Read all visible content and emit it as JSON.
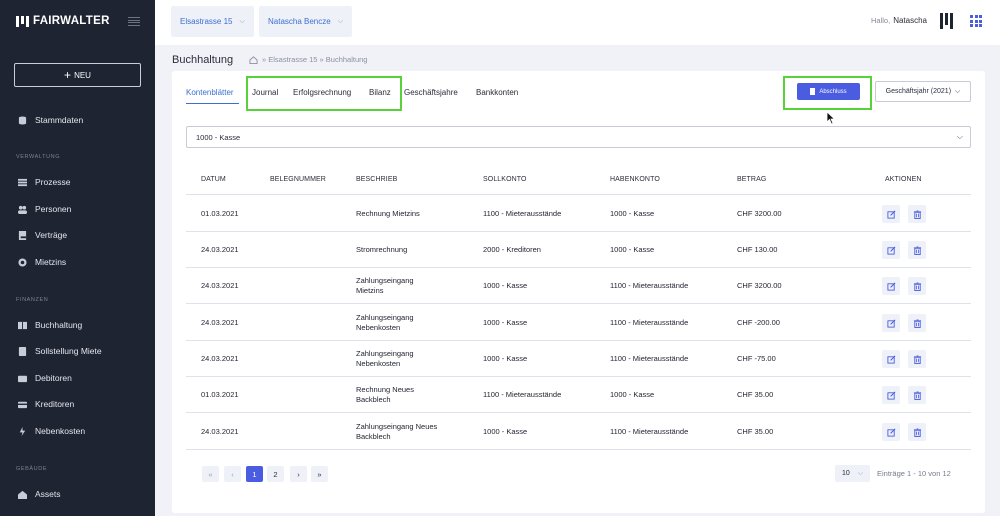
{
  "app": {
    "brand": "FAIRWALTER",
    "new_button": "NEU",
    "colors": {
      "accent": "#4a5ce0",
      "sidebar_bg": "#1f2433",
      "highlight": "#58d238",
      "link": "#3c6fd1"
    }
  },
  "sidebar": {
    "items": [
      {
        "label": "Stammdaten",
        "icon": "database-icon"
      },
      {
        "label": "Prozesse",
        "icon": "list-icon"
      },
      {
        "label": "Personen",
        "icon": "people-icon"
      },
      {
        "label": "Verträge",
        "icon": "contract-icon"
      },
      {
        "label": "Mietzins",
        "icon": "rent-icon"
      },
      {
        "label": "Buchhaltung",
        "icon": "ledger-icon"
      },
      {
        "label": "Sollstellung Miete",
        "icon": "invoice-icon"
      },
      {
        "label": "Debitoren",
        "icon": "debtor-icon"
      },
      {
        "label": "Kreditoren",
        "icon": "creditor-icon"
      },
      {
        "label": "Nebenkosten",
        "icon": "utility-icon"
      },
      {
        "label": "Assets",
        "icon": "assets-icon"
      }
    ],
    "sections": [
      "VERWALTUNG",
      "FINANZEN",
      "GEBÄUDE"
    ]
  },
  "topbar": {
    "property": "Elsastrasse 15",
    "owner": "Natascha Bencze",
    "greeting": "Hallo,",
    "user": "Natascha"
  },
  "page": {
    "title": "Buchhaltung",
    "breadcrumb": "» Elsastrasse 15 » Buchhaltung"
  },
  "tabs": [
    "Kontenblätter",
    "Journal",
    "Erfolgsrechnung",
    "Bilanz",
    "Geschäftsjahre",
    "Bankkonten"
  ],
  "abschluss_button": "Abschluss",
  "fiscal_year": "Geschäftsjahr (2021)",
  "account_select": "1000 - Kasse",
  "table": {
    "headers": [
      "DATUM",
      "BELEGNUMMER",
      "BESCHRIEB",
      "SOLLKONTO",
      "HABENKONTO",
      "BETRAG",
      "AKTIONEN"
    ],
    "rows": [
      {
        "datum": "01.03.2021",
        "beleg": "",
        "beschrieb": "Rechnung Mietzins",
        "beschrieb2": "",
        "soll": "1100 - Mieterausstände",
        "haben": "1000 - Kasse",
        "betrag": "CHF 3200.00"
      },
      {
        "datum": "24.03.2021",
        "beleg": "",
        "beschrieb": "Stromrechnung",
        "beschrieb2": "",
        "soll": "2000 - Kreditoren",
        "haben": "1000 - Kasse",
        "betrag": "CHF 130.00"
      },
      {
        "datum": "24.03.2021",
        "beleg": "",
        "beschrieb": "Zahlungseingang",
        "beschrieb2": "Mietzins",
        "soll": "1000 - Kasse",
        "haben": "1100 - Mieterausstände",
        "betrag": "CHF 3200.00"
      },
      {
        "datum": "24.03.2021",
        "beleg": "",
        "beschrieb": "Zahlungseingang",
        "beschrieb2": "Nebenkosten",
        "soll": "1000 - Kasse",
        "haben": "1100 - Mieterausstände",
        "betrag": "CHF -200.00"
      },
      {
        "datum": "24.03.2021",
        "beleg": "",
        "beschrieb": "Zahlungseingang",
        "beschrieb2": "Nebenkosten",
        "soll": "1000 - Kasse",
        "haben": "1100 - Mieterausstände",
        "betrag": "CHF -75.00"
      },
      {
        "datum": "01.03.2021",
        "beleg": "",
        "beschrieb": "Rechnung Neues",
        "beschrieb2": "Backblech",
        "soll": "1100 - Mieterausstände",
        "haben": "1000 - Kasse",
        "betrag": "CHF 35.00"
      },
      {
        "datum": "24.03.2021",
        "beleg": "",
        "beschrieb": "Zahlungseingang Neues",
        "beschrieb2": "Backblech",
        "soll": "1000 - Kasse",
        "haben": "1100 - Mieterausstände",
        "betrag": "CHF 35.00"
      }
    ]
  },
  "pagination": {
    "first": "«",
    "prev": "‹",
    "pages": [
      "1",
      "2"
    ],
    "next": "›",
    "last": "»",
    "current": "1",
    "per_page": "10",
    "entries": "Einträge 1 - 10 von 12"
  }
}
